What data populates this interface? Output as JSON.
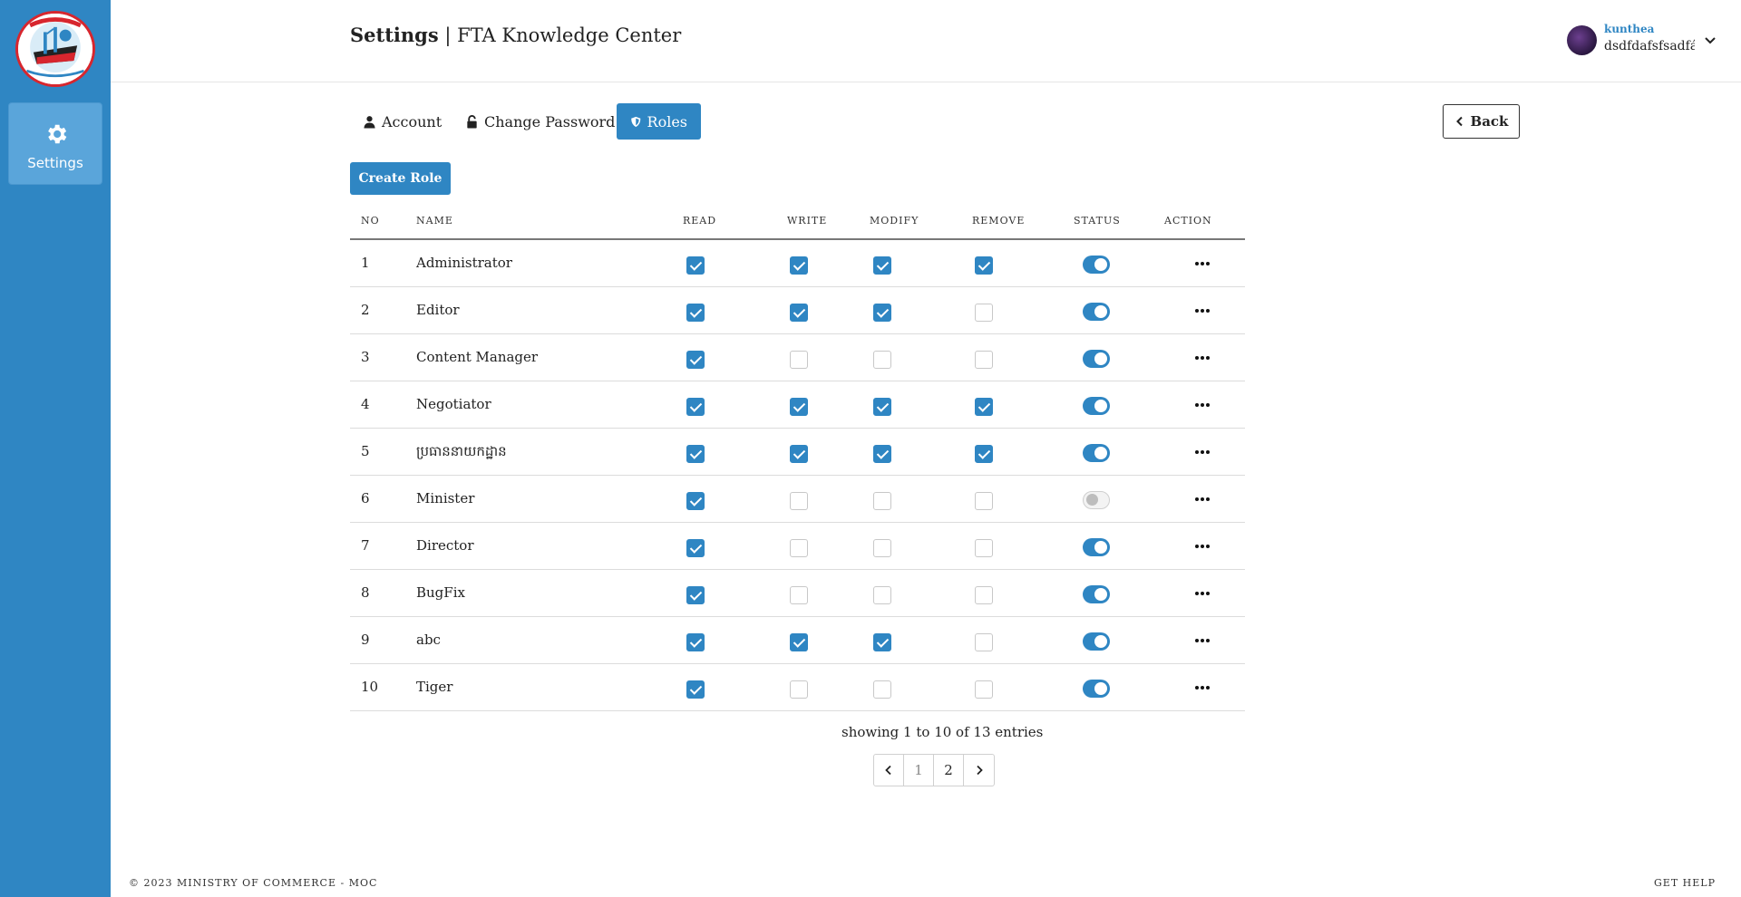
{
  "sidebar": {
    "items": [
      {
        "label": "Settings",
        "icon": "gear-icon"
      }
    ]
  },
  "header": {
    "title_bold": "Settings",
    "title_rest": " | FTA Knowledge Center",
    "user": {
      "name": "kunthea",
      "email": "dsdfdafsfsadfás"
    }
  },
  "tabs": [
    {
      "label": "Account",
      "icon": "user-icon",
      "active": false
    },
    {
      "label": "Change Password",
      "icon": "lock-icon",
      "active": false
    },
    {
      "label": "Roles",
      "icon": "shield-icon",
      "active": true
    }
  ],
  "buttons": {
    "back": "Back",
    "create_role": "Create Role"
  },
  "table": {
    "columns": [
      "NO",
      "NAME",
      "READ",
      "WRITE",
      "MODIFY",
      "REMOVE",
      "STATUS",
      "ACTION"
    ],
    "rows": [
      {
        "no": "1",
        "name": "Administrator",
        "read": true,
        "write": true,
        "modify": true,
        "remove": true,
        "status": true
      },
      {
        "no": "2",
        "name": "Editor",
        "read": true,
        "write": true,
        "modify": true,
        "remove": false,
        "status": true
      },
      {
        "no": "3",
        "name": "Content Manager",
        "read": true,
        "write": false,
        "modify": false,
        "remove": false,
        "status": true
      },
      {
        "no": "4",
        "name": "Negotiator",
        "read": true,
        "write": true,
        "modify": true,
        "remove": true,
        "status": true
      },
      {
        "no": "5",
        "name": "ប្រធាននាយកដ្ឋាន",
        "read": true,
        "write": true,
        "modify": true,
        "remove": true,
        "status": true
      },
      {
        "no": "6",
        "name": "Minister",
        "read": true,
        "write": false,
        "modify": false,
        "remove": false,
        "status": false
      },
      {
        "no": "7",
        "name": "Director",
        "read": true,
        "write": false,
        "modify": false,
        "remove": false,
        "status": true
      },
      {
        "no": "8",
        "name": "BugFix",
        "read": true,
        "write": false,
        "modify": false,
        "remove": false,
        "status": true
      },
      {
        "no": "9",
        "name": "abc",
        "read": true,
        "write": true,
        "modify": true,
        "remove": false,
        "status": true
      },
      {
        "no": "10",
        "name": "Tiger",
        "read": true,
        "write": false,
        "modify": false,
        "remove": false,
        "status": true
      }
    ]
  },
  "pagination": {
    "showing": "showing 1 to 10 of 13 entries",
    "pages": [
      "1",
      "2"
    ],
    "current": "2"
  },
  "footer": {
    "copyright": "© 2023 MINISTRY OF COMMERCE - MOC",
    "help": "GET HELP"
  },
  "colors": {
    "primary": "#2f86c3",
    "sidebar_active": "#5aa5da"
  }
}
